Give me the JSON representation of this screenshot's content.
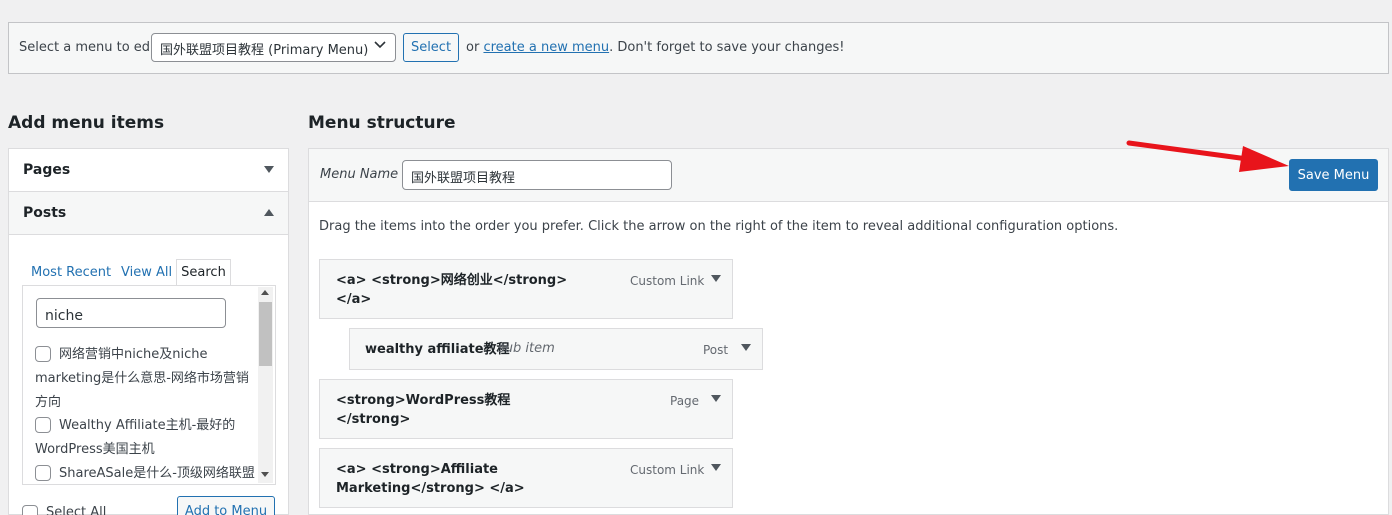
{
  "manage": {
    "label": "Select a menu to edit:",
    "selected_menu": "国外联盟项目教程 (Primary Menu)",
    "select_button": "Select",
    "or_text": "or",
    "create_link": "create a new menu",
    "save_reminder": ". Don't forget to save your changes!"
  },
  "left": {
    "heading": "Add menu items",
    "pages_label": "Pages",
    "posts_label": "Posts",
    "tabs": [
      "Most Recent",
      "View All",
      "Search"
    ],
    "search_value": "niche",
    "results": [
      {
        "lines": [
          "网络营销中niche及niche",
          "marketing是什么意思-网络市场营销",
          "方向"
        ]
      },
      {
        "lines": [
          "Wealthy Affiliate主机-最好的",
          "WordPress美国主机"
        ]
      },
      {
        "lines": [
          "ShareASale是什么-顶级网络联盟"
        ]
      }
    ],
    "select_all": "Select All",
    "add_button": "Add to Menu"
  },
  "right": {
    "heading": "Menu structure",
    "menu_name_label": "Menu Name",
    "menu_name_value": "国外联盟项目教程",
    "save_button": "Save Menu",
    "instructions": "Drag the items into the order you prefer. Click the arrow on the right of the item to reveal additional configuration options.",
    "items": [
      {
        "title_lines": [
          "<a> <strong>网络创业</strong>",
          "</a>"
        ],
        "sub": "",
        "type": "Custom Link"
      },
      {
        "title_lines": [
          "wealthy affiliate教程"
        ],
        "sub": "sub item",
        "type": "Post"
      },
      {
        "title_lines": [
          "<strong>WordPress教程",
          "</strong>"
        ],
        "sub": "",
        "type": "Page"
      },
      {
        "title_lines": [
          "<a> <strong>Affiliate",
          "Marketing</strong> </a>"
        ],
        "sub": "",
        "type": "Custom Link"
      }
    ]
  },
  "colors": {
    "primary": "#2271b1",
    "annotation_arrow": "#e8141b"
  },
  "icons": {
    "dropdown": "chevron-down-icon",
    "collapse": "triangle-down-icon",
    "expand": "triangle-up-icon"
  }
}
